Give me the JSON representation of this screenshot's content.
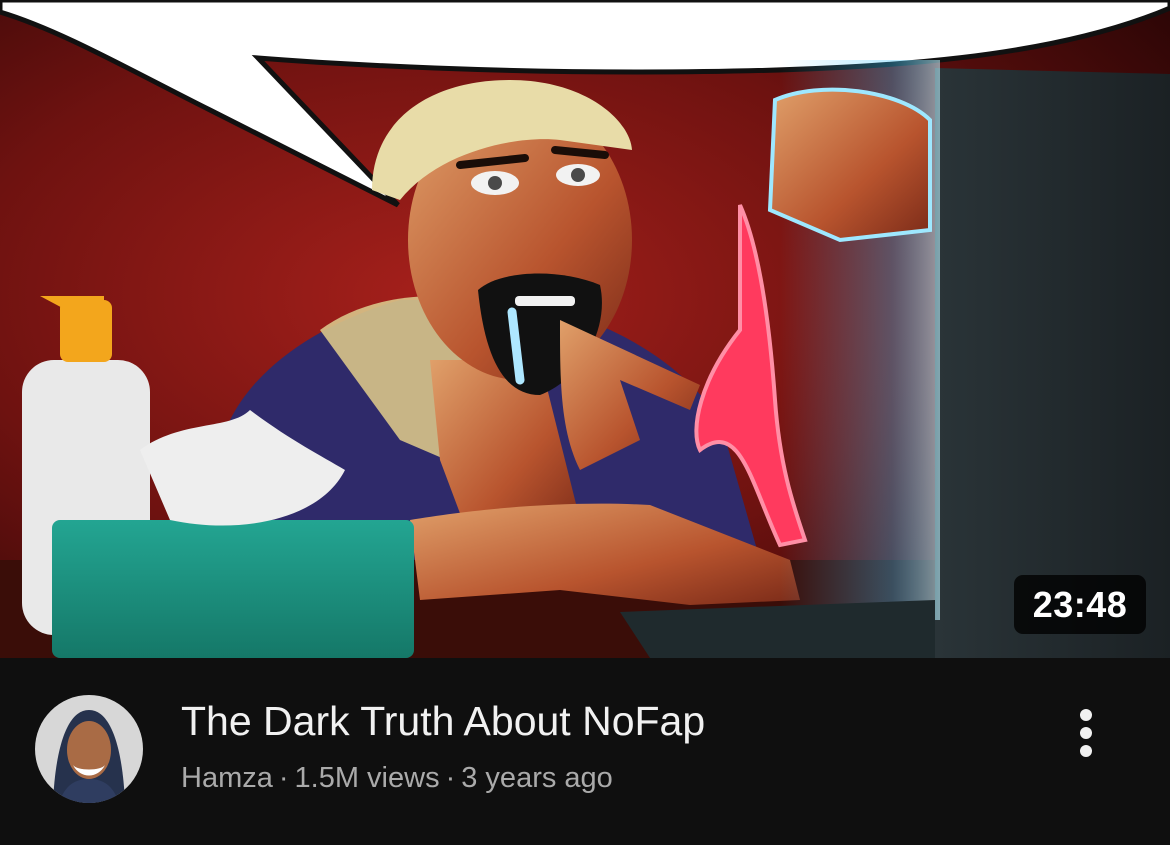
{
  "video": {
    "duration": "23:48",
    "title": "The Dark Truth About NoFap",
    "channel": "Hamza",
    "views": "1.5M views",
    "age": "3 years ago",
    "separator": "·"
  },
  "icons": {
    "more": "more-vertical-icon",
    "avatar": "channel-avatar"
  },
  "colors": {
    "background": "#0f0f0f",
    "title": "#f1f1f1",
    "meta": "#aaaaaa",
    "badge_bg": "#000000",
    "badge_text": "#ffffff"
  }
}
